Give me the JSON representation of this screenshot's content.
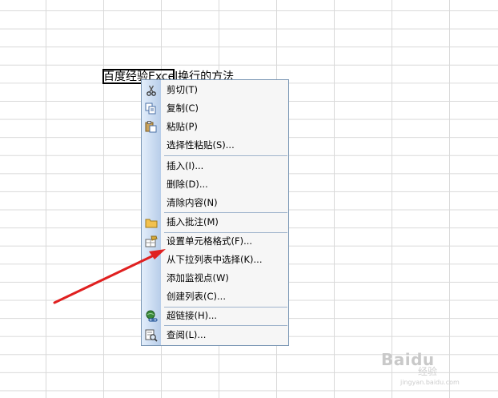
{
  "sheet": {
    "cell_text": "百度经验Excel换行的方法"
  },
  "context_menu": {
    "items": [
      {
        "label": "剪切(T)",
        "icon": "scissors-icon"
      },
      {
        "label": "复制(C)",
        "icon": "copy-icon"
      },
      {
        "label": "粘贴(P)",
        "icon": "paste-icon"
      },
      {
        "label": "选择性粘贴(S)...",
        "icon": ""
      },
      {
        "label": "插入(I)...",
        "icon": ""
      },
      {
        "label": "删除(D)...",
        "icon": ""
      },
      {
        "label": "清除内容(N)",
        "icon": ""
      },
      {
        "label": "插入批注(M)",
        "icon": "folder-icon"
      },
      {
        "label": "设置单元格格式(F)...",
        "icon": "format-cells-icon"
      },
      {
        "label": "从下拉列表中选择(K)...",
        "icon": ""
      },
      {
        "label": "添加监视点(W)",
        "icon": ""
      },
      {
        "label": "创建列表(C)...",
        "icon": ""
      },
      {
        "label": "超链接(H)...",
        "icon": "hyperlink-icon"
      },
      {
        "label": "查阅(L)...",
        "icon": "lookup-icon"
      }
    ]
  },
  "annotation": {
    "arrow_color": "#e02020"
  },
  "watermark": {
    "brand": "Baidu",
    "sub": "经验",
    "url": "jingyan.baidu.com"
  }
}
